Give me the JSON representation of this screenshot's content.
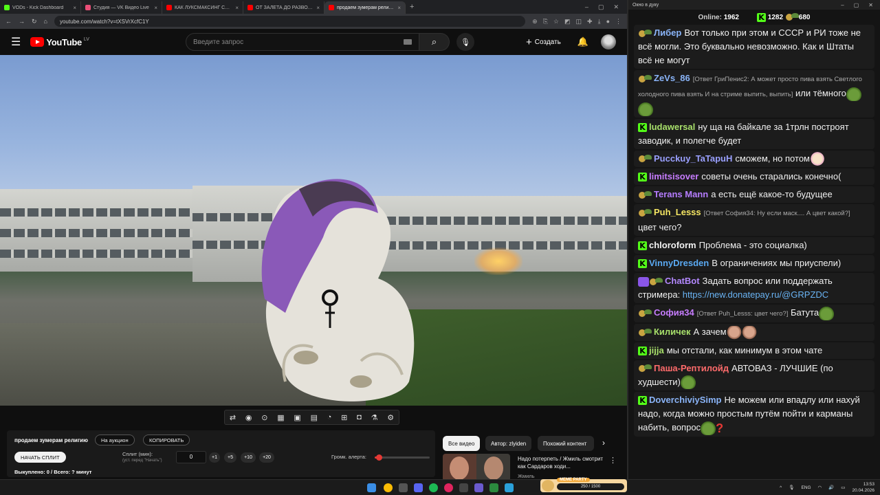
{
  "browser": {
    "tabs": [
      {
        "label": "VODs - Kick Dashboard",
        "color": "#53fc18",
        "active": false
      },
      {
        "label": "Студия — VK Видео Live",
        "color": "#e94e77",
        "active": false
      },
      {
        "label": "КАК ЛУКСМАКСИНГ СДЕЛАЛ",
        "color": "#ff0000",
        "active": false
      },
      {
        "label": "ОТ ЗАЛЕТА ДО РАЗВОДА: пои",
        "color": "#ff0000",
        "active": false
      },
      {
        "label": "продаем зумерам религию",
        "color": "#ff0000",
        "active": true
      }
    ],
    "url": "youtube.com/watch?v=tXSVrXcfC1Y"
  },
  "youtube": {
    "logo_text": "YouTube",
    "country_code": "LV",
    "search_placeholder": "Введите запрос",
    "create_label": "Создать"
  },
  "panel": {
    "video_title": "продаем зумерам религию",
    "auction_btn": "На аукцион",
    "copy_btn": "КОПИРОВАТЬ",
    "start_split_btn": "НАЧАТЬ СПЛИТ",
    "split_label": "Сплит (мин):",
    "split_hint": "(уст. перед \"Начать\")",
    "split_value": "0",
    "increments": [
      "+1",
      "+5",
      "+10",
      "+20"
    ],
    "alert_volume_label": "Громк. алерта:",
    "alert_volume_fraction": 0.08,
    "bought_text": "Выкуплено: 0 / Всего: ? минут"
  },
  "related": {
    "chips": [
      "Все видео",
      "Автор: zlyiden",
      "Похожий контент"
    ],
    "video_title": "Надо потерпеть / Жмиль смотрит как Сардаров ходи...",
    "channel": "Жмиль"
  },
  "chat": {
    "window_title": "Окно в дуку",
    "online_label": "Online:",
    "online_value": "1962",
    "kick_count": "1282",
    "yt_count": "680",
    "messages": [
      {
        "badge": "yt",
        "user": "Либер",
        "color": "#8ab4f8",
        "reply": "",
        "text": "Вот только при этом и СССР и РИ тоже не всё могли. Это буквально невозможно. Как и Штаты всё не могут",
        "emotes": []
      },
      {
        "badge": "yt",
        "user": "ZeVs_86",
        "color": "#8ab4f8",
        "reply": "[Ответ ГриПенис2: А может просто пива взять Светлого холодного пива взять И на стриме выпить, выпить]",
        "text": "или тёмного",
        "emotes": [
          "frog",
          "frog"
        ]
      },
      {
        "badge": "kick",
        "user": "ludawersal",
        "color": "#a8e06b",
        "reply": "",
        "text": "ну ща на байкале за 1трлн построят заводик, и полегче будет",
        "emotes": []
      },
      {
        "badge": "yt",
        "user": "Pucckuy_TaTapuH",
        "color": "#9aa0ff",
        "reply": "",
        "text": "сможем, но потом",
        "emotes": [
          "pony"
        ]
      },
      {
        "badge": "kick",
        "user": "limitsisover",
        "color": "#c77dff",
        "reply": "",
        "text": "советы очень старались конечно(",
        "emotes": []
      },
      {
        "badge": "yt",
        "user": "Terans Mann",
        "color": "#b67dff",
        "reply": "",
        "text": "а есть ещё какое-то будущее",
        "emotes": []
      },
      {
        "badge": "yt",
        "user": "Puh_Lesss",
        "color": "#f5e663",
        "reply": "[Ответ София34: Ну если маск.... А цвет какой?]",
        "text": "цвет чего?",
        "emotes": []
      },
      {
        "badge": "kick",
        "user": "chloroform",
        "color": "#f2f2f2",
        "reply": "",
        "text": "Проблема - это социалка)",
        "emotes": []
      },
      {
        "badge": "kick",
        "user": "VinnyDresden",
        "color": "#5aa9f2",
        "reply": "",
        "text": "В ограничениях мы приуспели)",
        "emotes": []
      },
      {
        "badge": "bot",
        "user": "ChatBot",
        "color": "#b388ff",
        "reply": "",
        "text": "Задать вопрос или поддержать стримера: ",
        "link": "https://new.donatepay.ru/@GRPZDC",
        "emotes": []
      },
      {
        "badge": "yt",
        "user": "София34",
        "color": "#c77dff",
        "reply": "[Ответ Puh_Lesss: цвет чего?]",
        "text": "Батута",
        "emotes": [
          "frog"
        ]
      },
      {
        "badge": "yt",
        "user": "Киличек",
        "color": "#a8e06b",
        "reply": "",
        "text": "А зачем",
        "emotes": [
          "face",
          "face"
        ]
      },
      {
        "badge": "kick",
        "user": "jijja",
        "color": "#a8e06b",
        "reply": "",
        "text": "мы отстали, как минимум в этом чате",
        "emotes": []
      },
      {
        "badge": "yt",
        "user": "Паша-Рептилойд",
        "color": "#ff6b6b",
        "reply": "",
        "text": "АВТОВАЗ - ЛУЧШИЕ (по худшести)",
        "emotes": [
          "frog"
        ]
      },
      {
        "badge": "kick",
        "user": "DoverchiviySimp",
        "color": "#8ab4f8",
        "reply": "",
        "text": "Не можем или впадлу или нахуй надо, когда можно простым путём пойти и карманы набить, вопрос",
        "emotes": [
          "frog",
          "q"
        ]
      }
    ]
  },
  "taskbar": {
    "lang": "ENG",
    "time": "13:53",
    "date": "20.04.2026",
    "meme_label": "MEME PARTY",
    "meme_progress": "250 / 1500"
  }
}
